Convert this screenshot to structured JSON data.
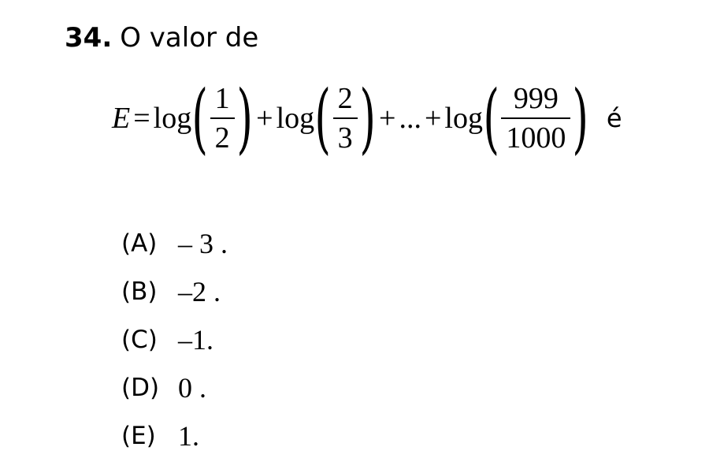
{
  "question": {
    "number": "34.",
    "stem": "O valor de"
  },
  "equation": {
    "lhs": "E",
    "equals": "=",
    "log1": "log",
    "frac1_num": "1",
    "frac1_den": "2",
    "plus1": "+",
    "log2": "log",
    "frac2_num": "2",
    "frac2_den": "3",
    "plus2": "+",
    "ellipsis": "...",
    "plus3": "+",
    "log3": "log",
    "frac3_num": "999",
    "frac3_den": "1000",
    "trailing": "é"
  },
  "options": [
    {
      "letter": "(A)",
      "value": "– 3 ."
    },
    {
      "letter": "(B)",
      "value": "–2 ."
    },
    {
      "letter": "(C)",
      "value": "–1."
    },
    {
      "letter": "(D)",
      "value": "0 ."
    },
    {
      "letter": "(E)",
      "value": "1."
    }
  ]
}
